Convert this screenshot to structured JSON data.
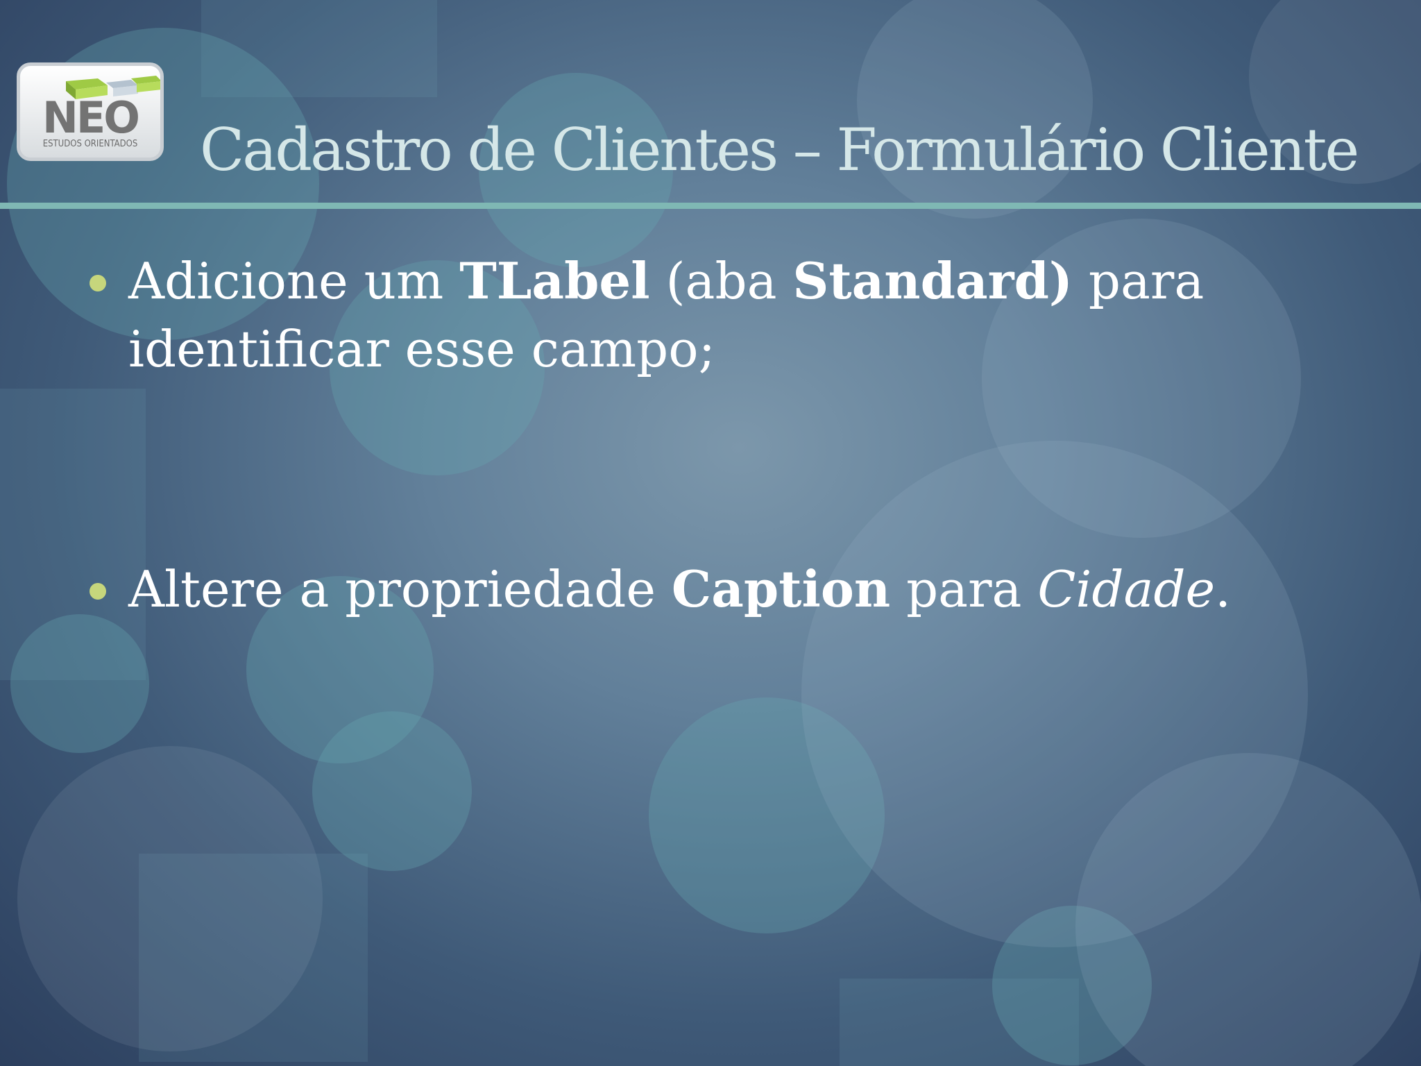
{
  "logo": {
    "brand": "NEO",
    "tagline": "ESTUDOS ORIENTADOS"
  },
  "slide": {
    "title": "Cadastro de Clientes – Formulário Cliente",
    "bullets": [
      {
        "before": "Adicione um ",
        "component": "TLabel",
        "paren_open": " (aba ",
        "tab": "Standard",
        "paren_close": ")",
        "after": "  para identificar esse campo;"
      },
      {
        "before": "Altere a propriedade ",
        "property": "Caption",
        "middle": " para ",
        "value": "Cidade",
        "end": "."
      }
    ]
  },
  "colors": {
    "title_text": "#d5e7e8",
    "rule": "#7fb8b4",
    "bullet_dot": "#c6d67c",
    "body_text": "#ffffff"
  }
}
